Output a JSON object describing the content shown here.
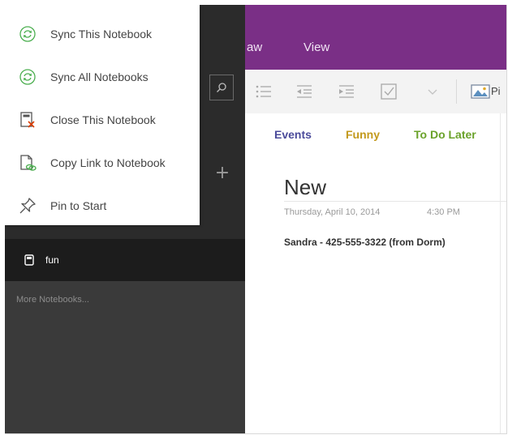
{
  "context_menu": {
    "items": [
      {
        "label": "Sync This Notebook",
        "icon": "sync-icon"
      },
      {
        "label": "Sync All Notebooks",
        "icon": "sync-icon"
      },
      {
        "label": "Close This Notebook",
        "icon": "close-notebook-icon"
      },
      {
        "label": "Copy Link to Notebook",
        "icon": "copy-link-icon"
      },
      {
        "label": "Pin to Start",
        "icon": "pin-icon"
      }
    ],
    "colors": {
      "sync_icon": "#4caf50",
      "close_icon": "#d83b01"
    }
  },
  "sidebar": {
    "add_glyph": "+",
    "notebook": {
      "label": "fun",
      "icon": "notebook-icon"
    },
    "more_notebooks": "More Notebooks..."
  },
  "ribbon": {
    "tabs": [
      "aw",
      "View"
    ],
    "tools": [
      "bullet-list-icon",
      "decrease-indent-icon",
      "increase-indent-icon",
      "checkbox-icon",
      "dropdown-chevron-icon",
      "picture-icon"
    ],
    "picture_label": "Pi",
    "accent": "#7a2f86"
  },
  "sections": [
    {
      "label": "Events",
      "color": "#4b4b9b"
    },
    {
      "label": "Funny",
      "color": "#c39a1e"
    },
    {
      "label": "To Do Later",
      "color": "#6aa22a"
    }
  ],
  "page": {
    "title": "New",
    "date": "Thursday, April 10, 2014",
    "time": "4:30 PM",
    "note": "Sandra - 425-555-3322 (from Dorm)"
  }
}
